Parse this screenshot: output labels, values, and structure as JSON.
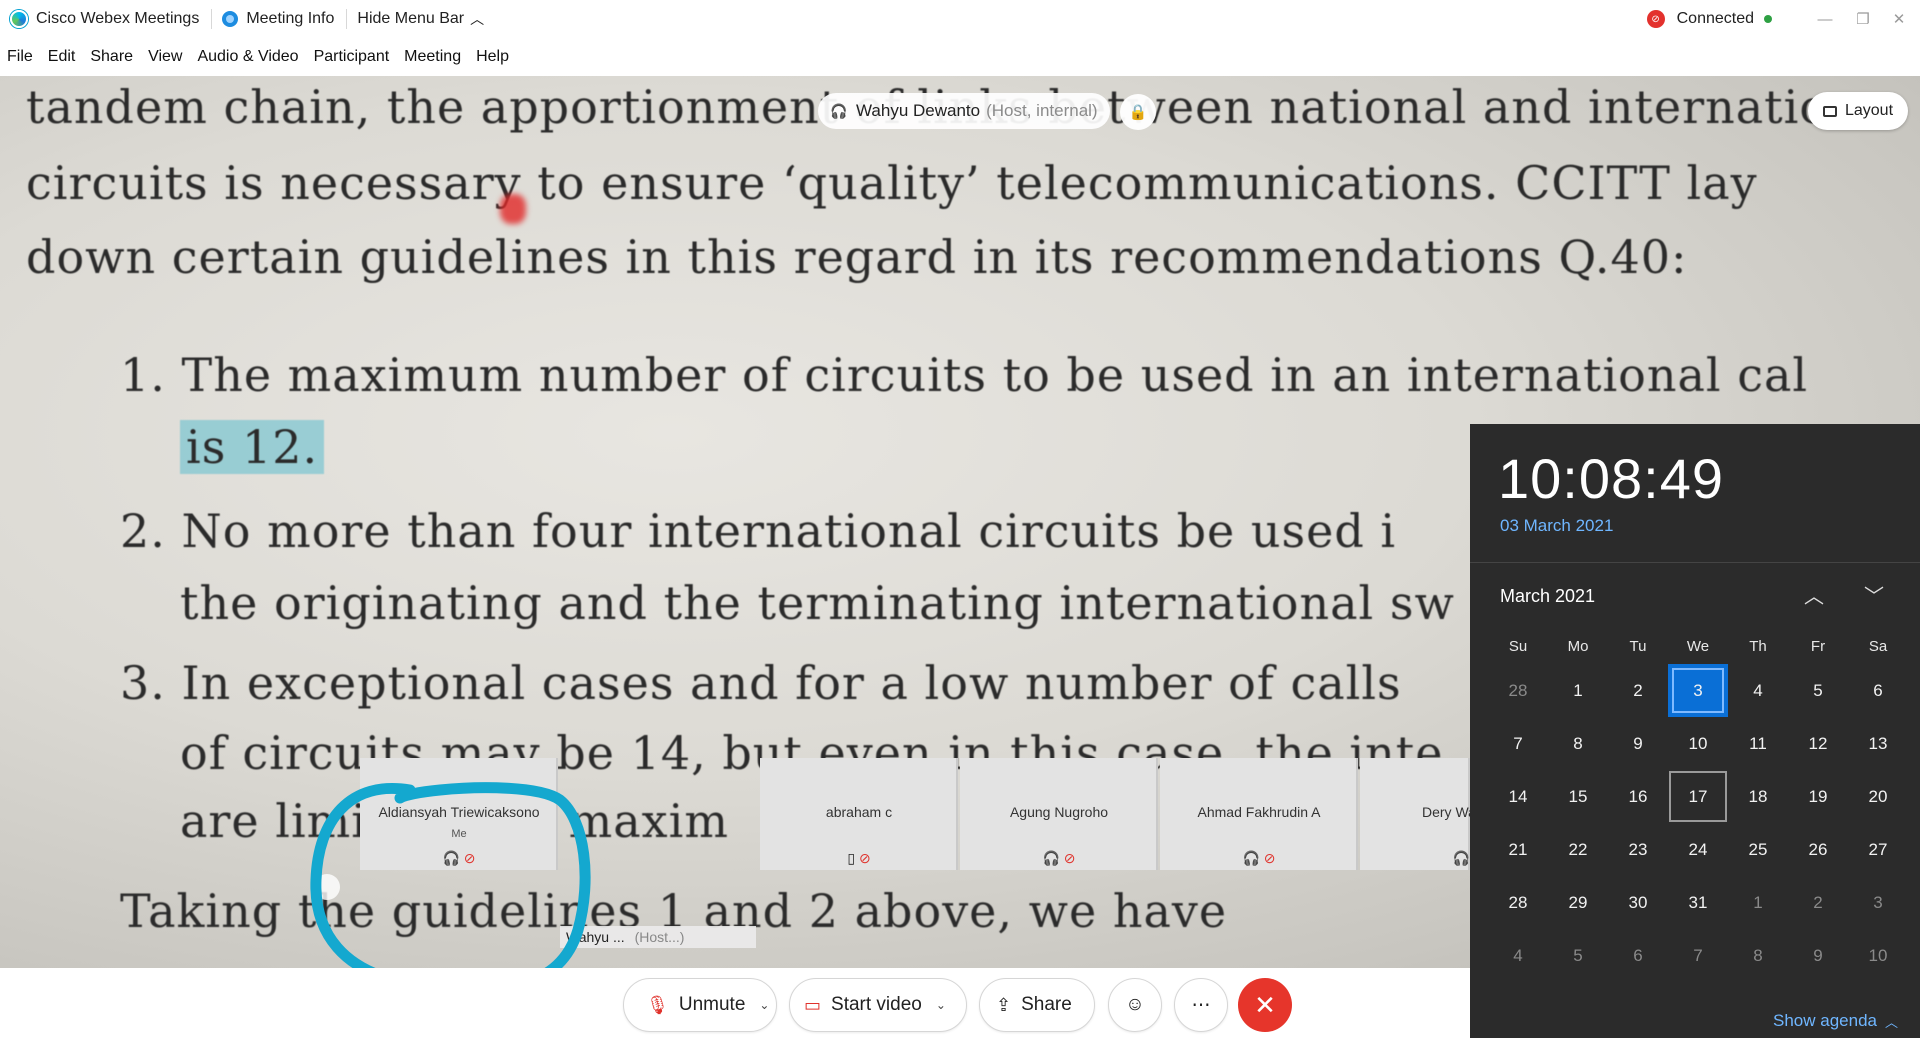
{
  "titlebar": {
    "app_name": "Cisco Webex Meetings",
    "meeting_info": "Meeting Info",
    "hide_menu": "Hide Menu Bar",
    "connection_status": "Connected"
  },
  "menu": [
    "File",
    "Edit",
    "Share",
    "View",
    "Audio & Video",
    "Participant",
    "Meeting",
    "Help"
  ],
  "stage": {
    "presenter_name": "Wahyu Dewanto",
    "presenter_role": "(Host, internal)",
    "layout_label": "Layout",
    "document_lines": [
      "tandem chain, the apportionment of links between national and internationa",
      "circuits is necessary to ensure ‘quality’ telecommunications. CCITT lay",
      "down certain guidelines in this regard in its recommendations Q.40:",
      "1.  The maximum number of circuits to be used in an international cal",
      "is 12.",
      "2.  No more than four international circuits be used i",
      "the originating and the terminating international sw",
      "3.  In exceptional cases and for a low number of calls",
      "of circuits may be 14, but even in this case, the inte",
      "are limited to a maxim",
      "Taking the guidelines 1 and 2 above, we have"
    ]
  },
  "participants": [
    {
      "name": "Aldiansyah Triewicaksono",
      "tag": "Me"
    },
    {
      "name": "abraham c",
      "tag": ""
    },
    {
      "name": "Agung Nugroho",
      "tag": ""
    },
    {
      "name": "Ahmad Fakhrudin A",
      "tag": ""
    },
    {
      "name": "Dery Wa",
      "tag": ""
    }
  ],
  "active_speaker": {
    "name": "Wahyu ...",
    "role": "(Host...)"
  },
  "controls": {
    "unmute": "Unmute",
    "start_video": "Start video",
    "share": "Share"
  },
  "clock": {
    "time": "10:08:49",
    "date": "03 March 2021",
    "month_title": "March 2021",
    "weekdays": [
      "Su",
      "Mo",
      "Tu",
      "We",
      "Th",
      "Fr",
      "Sa"
    ],
    "days": [
      {
        "n": "28",
        "dim": true
      },
      {
        "n": "1"
      },
      {
        "n": "2"
      },
      {
        "n": "3",
        "today": true
      },
      {
        "n": "4"
      },
      {
        "n": "5"
      },
      {
        "n": "6"
      },
      {
        "n": "7"
      },
      {
        "n": "8"
      },
      {
        "n": "9"
      },
      {
        "n": "10"
      },
      {
        "n": "11"
      },
      {
        "n": "12"
      },
      {
        "n": "13"
      },
      {
        "n": "14"
      },
      {
        "n": "15"
      },
      {
        "n": "16"
      },
      {
        "n": "17",
        "marked": true
      },
      {
        "n": "18"
      },
      {
        "n": "19"
      },
      {
        "n": "20"
      },
      {
        "n": "21"
      },
      {
        "n": "22"
      },
      {
        "n": "23"
      },
      {
        "n": "24"
      },
      {
        "n": "25"
      },
      {
        "n": "26"
      },
      {
        "n": "27"
      },
      {
        "n": "28"
      },
      {
        "n": "29"
      },
      {
        "n": "30"
      },
      {
        "n": "31"
      },
      {
        "n": "1",
        "dim": true
      },
      {
        "n": "2",
        "dim": true
      },
      {
        "n": "3",
        "dim": true
      },
      {
        "n": "4",
        "dim": true
      },
      {
        "n": "5",
        "dim": true
      },
      {
        "n": "6",
        "dim": true
      },
      {
        "n": "7",
        "dim": true
      },
      {
        "n": "8",
        "dim": true
      },
      {
        "n": "9",
        "dim": true
      },
      {
        "n": "10",
        "dim": true
      }
    ],
    "agenda_label": "Show agenda"
  },
  "colors": {
    "accent": "#0a6fd6",
    "end_call": "#e6352b",
    "annotation": "#14a8cf",
    "highlight": "#5cbecd"
  }
}
